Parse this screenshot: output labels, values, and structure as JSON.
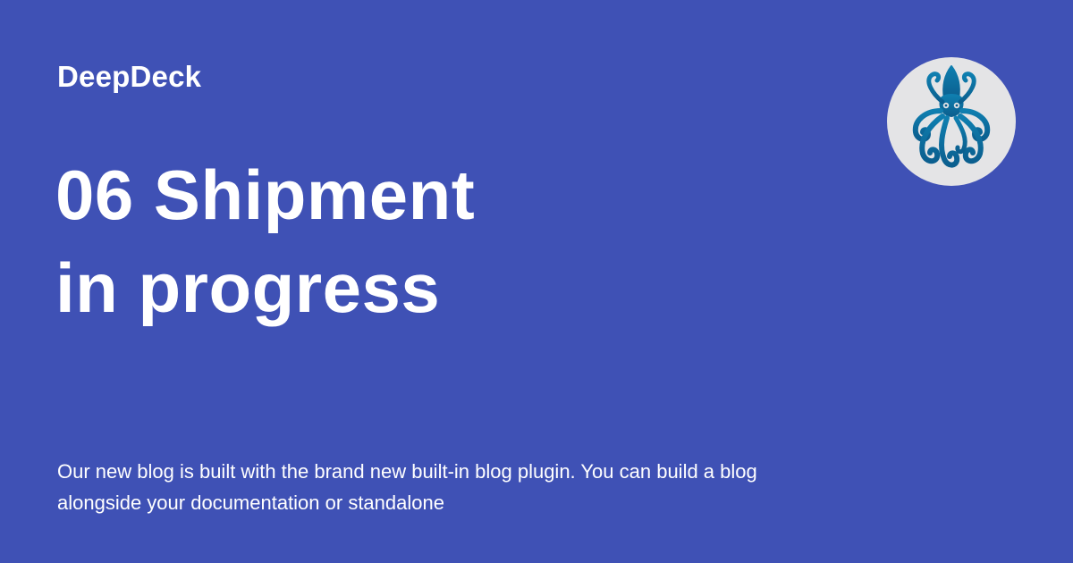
{
  "brand": {
    "site_name": "DeepDeck",
    "logo_icon": "squid-icon",
    "background_color": "#3f51b5",
    "logo_color": "#0e72a0",
    "logo_bg_color": "#e4e4e6"
  },
  "post": {
    "title_line_1": "06 Shipment",
    "title_line_2": "in progress",
    "description": "Our new blog is built with the brand new built-in blog plugin. You can build a blog alongside your documentation or standalone"
  }
}
